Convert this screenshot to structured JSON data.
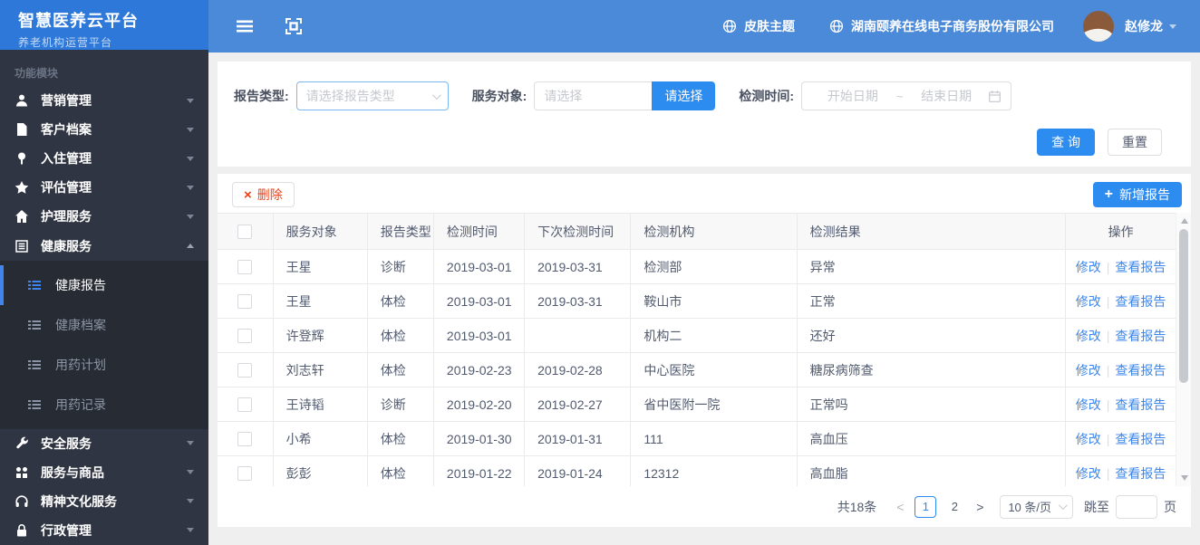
{
  "app": {
    "title": "智慧医养云平台",
    "subtitle": "养老机构运营平台"
  },
  "topbar": {
    "skin_theme": "皮肤主题",
    "company": "湖南颐养在线电子商务股份有限公司",
    "username": "赵修龙"
  },
  "sidebar": {
    "section_label": "功能模块",
    "items": [
      {
        "label": "营销管理",
        "icon": "user-icon"
      },
      {
        "label": "客户档案",
        "icon": "document-icon"
      },
      {
        "label": "入住管理",
        "icon": "tree-icon"
      },
      {
        "label": "评估管理",
        "icon": "star-icon"
      },
      {
        "label": "护理服务",
        "icon": "home-icon"
      },
      {
        "label": "健康服务",
        "icon": "health-list-icon",
        "expanded": true
      },
      {
        "label": "安全服务",
        "icon": "wrench-icon"
      },
      {
        "label": "服务与商品",
        "icon": "grid-icon"
      },
      {
        "label": "精神文化服务",
        "icon": "headphones-icon"
      },
      {
        "label": "行政管理",
        "icon": "lock-icon"
      }
    ],
    "health_submenu": [
      {
        "label": "健康报告",
        "active": true
      },
      {
        "label": "健康档案",
        "active": false
      },
      {
        "label": "用药计划",
        "active": false
      },
      {
        "label": "用药记录",
        "active": false
      }
    ]
  },
  "filters": {
    "report_type": {
      "label": "报告类型:",
      "placeholder": "请选择报告类型"
    },
    "service_target": {
      "label": "服务对象:",
      "placeholder": "请选择",
      "button": "请选择"
    },
    "detect_time": {
      "label": "检测时间:",
      "start_placeholder": "开始日期",
      "separator": "~",
      "end_placeholder": "结束日期"
    },
    "query_button": "查 询",
    "reset_button": "重置"
  },
  "toolbar": {
    "delete_button": "删除",
    "add_button": "新增报告"
  },
  "table": {
    "columns": [
      "服务对象",
      "报告类型",
      "检测时间",
      "下次检测时间",
      "检测机构",
      "检测结果",
      "操作"
    ],
    "actions": {
      "edit": "修改",
      "separator": "|",
      "view": "查看报告"
    },
    "rows": [
      {
        "name": "王星",
        "type": "诊断",
        "time": "2019-03-01",
        "next": "2019-03-31",
        "org": "检测部",
        "result": "异常"
      },
      {
        "name": "王星",
        "type": "体检",
        "time": "2019-03-01",
        "next": "2019-03-31",
        "org": "鞍山市",
        "result": "正常"
      },
      {
        "name": "许登辉",
        "type": "体检",
        "time": "2019-03-01",
        "next": "",
        "org": "机构二",
        "result": "还好"
      },
      {
        "name": "刘志轩",
        "type": "体检",
        "time": "2019-02-23",
        "next": "2019-02-28",
        "org": "中心医院",
        "result": "糖尿病筛查"
      },
      {
        "name": "王诗韬",
        "type": "诊断",
        "time": "2019-02-20",
        "next": "2019-02-27",
        "org": "省中医附一院",
        "result": "正常吗"
      },
      {
        "name": "小希",
        "type": "体检",
        "time": "2019-01-30",
        "next": "2019-01-31",
        "org": "111",
        "result": "高血压"
      },
      {
        "name": "彭彭",
        "type": "体检",
        "time": "2019-01-22",
        "next": "2019-01-24",
        "org": "12312",
        "result": "高血脂"
      }
    ]
  },
  "pagination": {
    "total": "共18条",
    "prev": "<",
    "pages": [
      "1",
      "2"
    ],
    "active_page": "1",
    "next": ">",
    "page_size": "10 条/页",
    "jump_label": "跳至",
    "jump_unit": "页"
  },
  "colors": {
    "primary": "#2d8cf0",
    "topbar_bg": "#4b8ad8",
    "logo_bg": "#2d78d8",
    "sidebar_bg": "#2f3542",
    "submenu_bg": "#262b34",
    "submenu_active": "#3f85ed",
    "content_bg": "#efefef",
    "danger": "#ed4014",
    "link": "#3d87ea",
    "table_border": "#e8eaec",
    "table_header_bg": "#f8f8f9"
  }
}
